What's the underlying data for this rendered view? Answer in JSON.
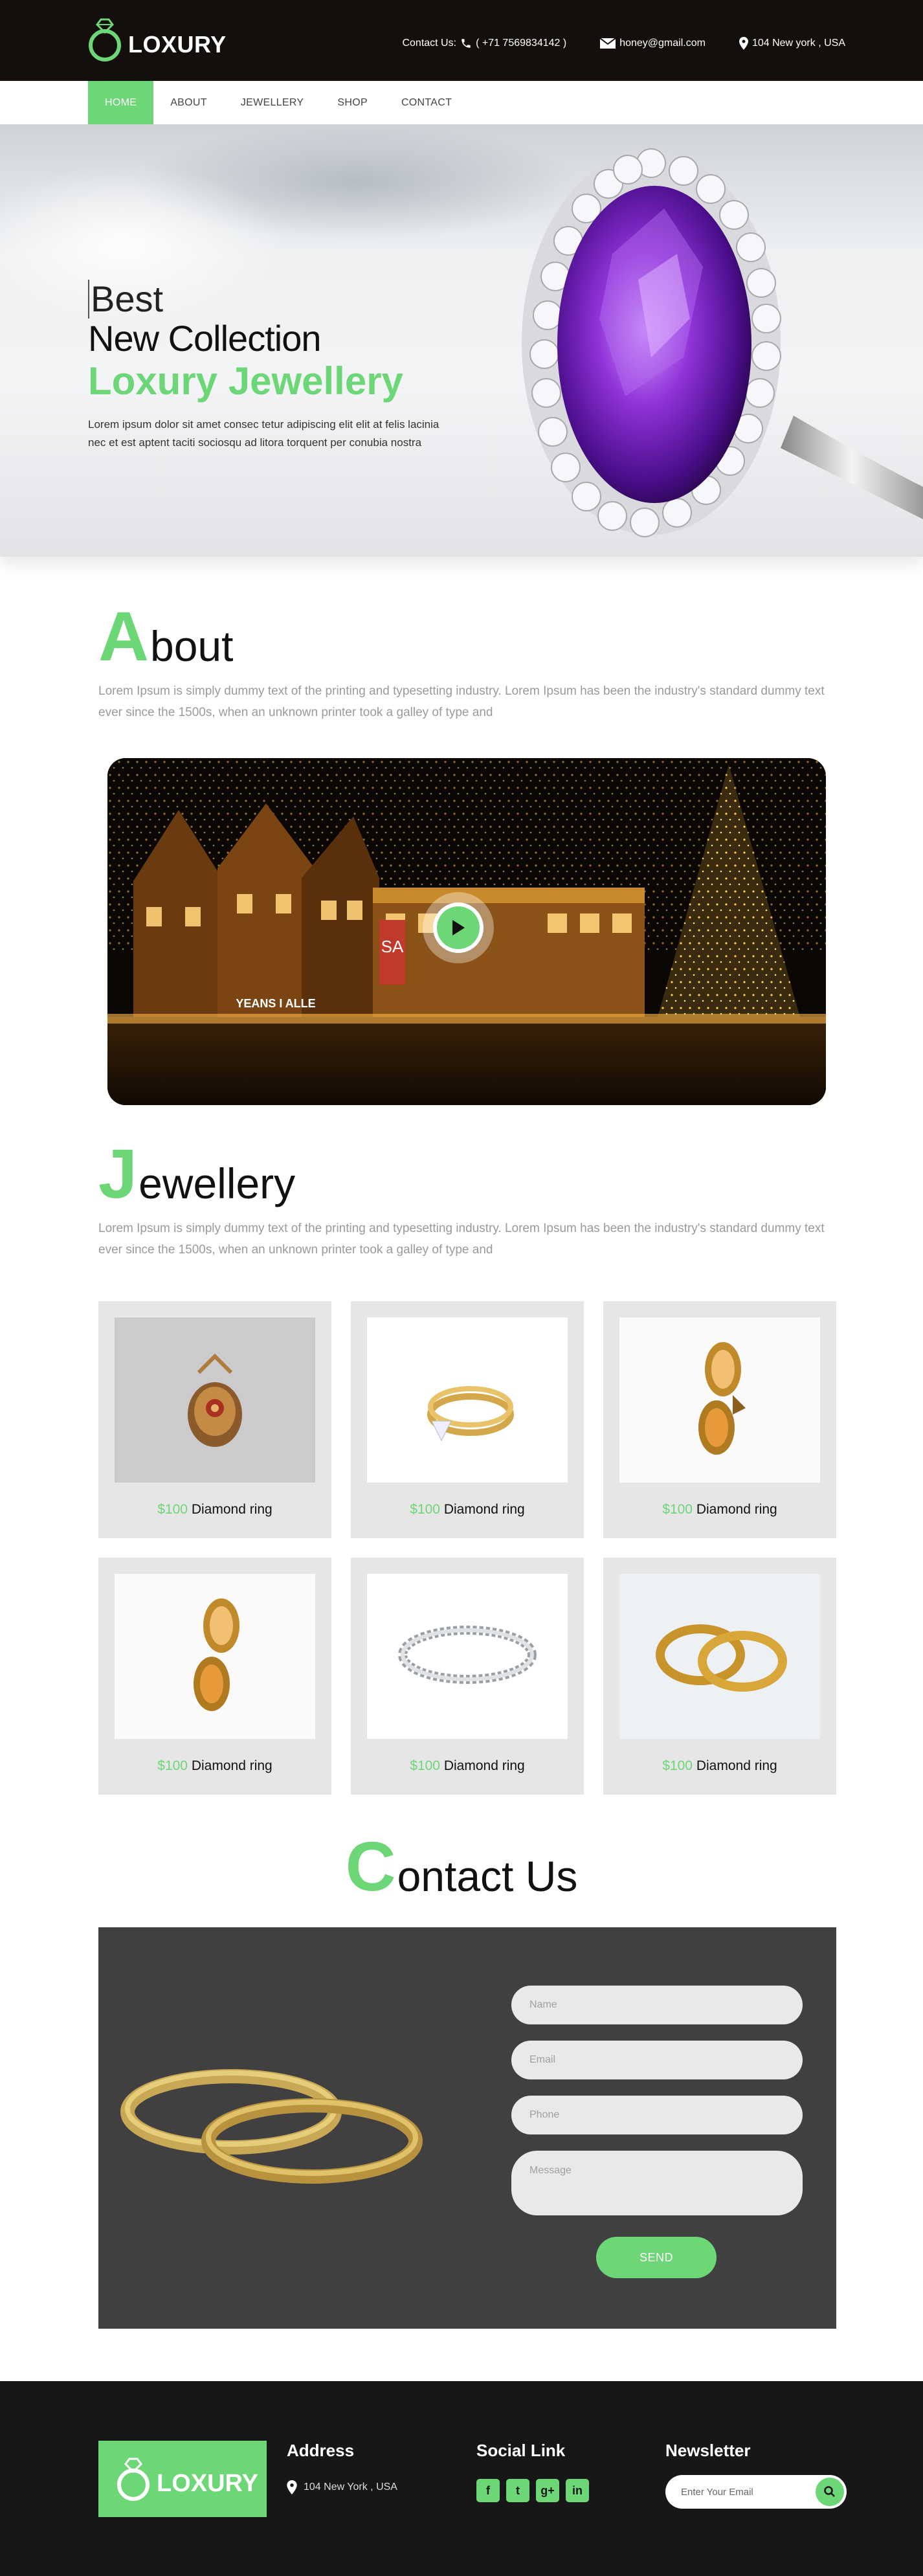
{
  "header": {
    "logo_text": "LOXURY",
    "contact_label": "Contact Us:",
    "phone": "( +71 7569834142 )",
    "email": "honey@gmail.com",
    "address": "104 New york , USA",
    "icons": [
      "phone-icon",
      "mail-icon",
      "location-icon"
    ]
  },
  "nav": {
    "items": [
      {
        "label": "HOME",
        "active": true
      },
      {
        "label": "ABOUT",
        "active": false
      },
      {
        "label": "JEWELLERY",
        "active": false
      },
      {
        "label": "SHOP",
        "active": false
      },
      {
        "label": "CONTACT",
        "active": false
      }
    ]
  },
  "hero": {
    "line1": "Best",
    "line2": "New Collection",
    "line3": "Loxury Jewellery",
    "text": "Lorem ipsum dolor sit amet consec tetur adipiscing elit elit at felis lacinia nec et est aptent taciti sociosqu ad litora torquent per conubia nostra"
  },
  "about": {
    "letter": "A",
    "rest": "bout",
    "text": "Lorem Ipsum is simply dummy text of the printing and typesetting industry. Lorem Ipsum has been the industry's standard dummy text ever since the 1500s, when an unknown printer took a galley of type and",
    "video_sign_left": "YEANS I ALLE",
    "video_sign_right": "SA"
  },
  "jewellery": {
    "letter": "J",
    "rest": "ewellery",
    "text": "Lorem Ipsum is simply dummy text of the printing and typesetting industry. Lorem Ipsum has been the industry's standard dummy text ever since the 1500s, when an unknown printer took a galley of type and",
    "products": [
      {
        "price": "$100",
        "name": "Diamond ring"
      },
      {
        "price": "$100",
        "name": "Diamond ring"
      },
      {
        "price": "$100",
        "name": "Diamond ring"
      },
      {
        "price": "$100",
        "name": "Diamond ring"
      },
      {
        "price": "$100",
        "name": "Diamond ring"
      },
      {
        "price": "$100",
        "name": "Diamond ring"
      }
    ]
  },
  "contact": {
    "letter": "C",
    "rest": "ontact Us",
    "name_placeholder": "Name",
    "email_placeholder": "Email",
    "phone_placeholder": "Phone",
    "message_placeholder": "Message",
    "send_label": "SEND"
  },
  "footer": {
    "logo_text": "LOXURY",
    "address_title": "Address",
    "address": "104 New York , USA",
    "social_title": "Social Link",
    "social": [
      "facebook-icon",
      "twitter-icon",
      "google-plus-icon",
      "linkedin-icon"
    ],
    "newsletter_title": "Newsletter",
    "newsletter_placeholder": "Enter Your Email"
  },
  "colors": {
    "accent": "#6dd676",
    "dark": "#140e0c",
    "footer": "#171717",
    "contact_bg": "#404040",
    "card_bg": "#e6e6e6"
  }
}
